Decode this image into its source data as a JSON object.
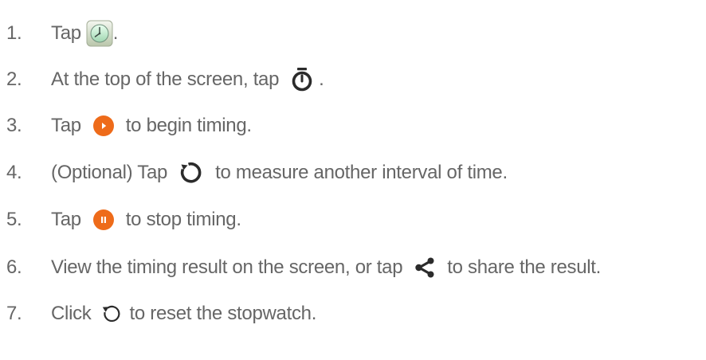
{
  "steps": [
    {
      "number": "1.",
      "before": "Tap",
      "icon": "clock-app-icon",
      "after": "."
    },
    {
      "number": "2.",
      "before": "At the top of the screen, tap",
      "icon": "stopwatch-icon",
      "after": "."
    },
    {
      "number": "3.",
      "before": "Tap",
      "icon": "start-button-icon",
      "after": "to begin timing."
    },
    {
      "number": "4.",
      "before": "(Optional) Tap",
      "icon": "lap-icon",
      "after": "to measure another interval of time."
    },
    {
      "number": "5.",
      "before": "Tap",
      "icon": "pause-button-icon",
      "after": "to stop timing."
    },
    {
      "number": "6.",
      "before": "View the timing result on the screen, or tap",
      "icon": "share-icon",
      "after": "to share the result."
    },
    {
      "number": "7.",
      "before": "Click",
      "icon": "reset-icon",
      "after": "to reset the stopwatch."
    }
  ],
  "colors": {
    "text": "#666666",
    "icon_dark": "#2b2b2b",
    "accent_orange": "#ee6b1a"
  }
}
